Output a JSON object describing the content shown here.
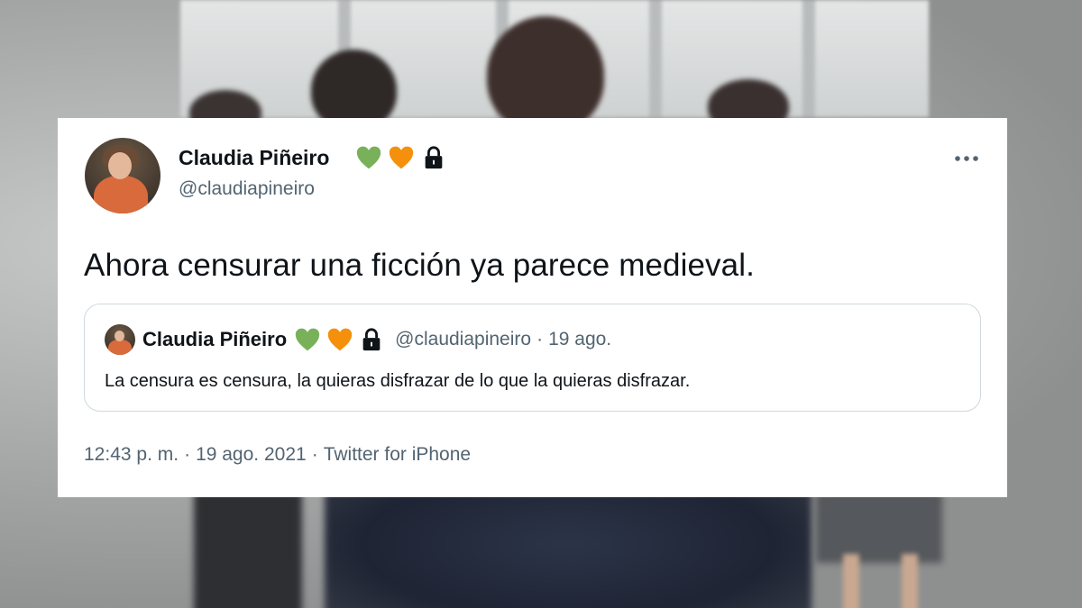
{
  "tweet": {
    "author": {
      "name": "Claudia Piñeiro",
      "handle": "@claudiapineiro"
    },
    "badges": {
      "icons": [
        "green-heart-icon",
        "orange-heart-icon",
        "lock-icon"
      ],
      "colors": {
        "green_heart": "#78b159",
        "orange_heart": "#f4900c",
        "lock": "#0f1419"
      }
    },
    "text": "Ahora censurar una ficción ya parece medieval.",
    "quoted": {
      "name": "Claudia Piñeiro",
      "handle": "@claudiapineiro",
      "separator": "·",
      "date": "19 ago.",
      "text": "La censura es censura, la quieras disfrazar de lo que la quieras disfrazar."
    },
    "meta": {
      "time": "12:43 p. m.",
      "separator": "·",
      "date": "19 ago. 2021",
      "source": "Twitter for iPhone"
    },
    "more_icon": "more-horizontal-icon"
  }
}
